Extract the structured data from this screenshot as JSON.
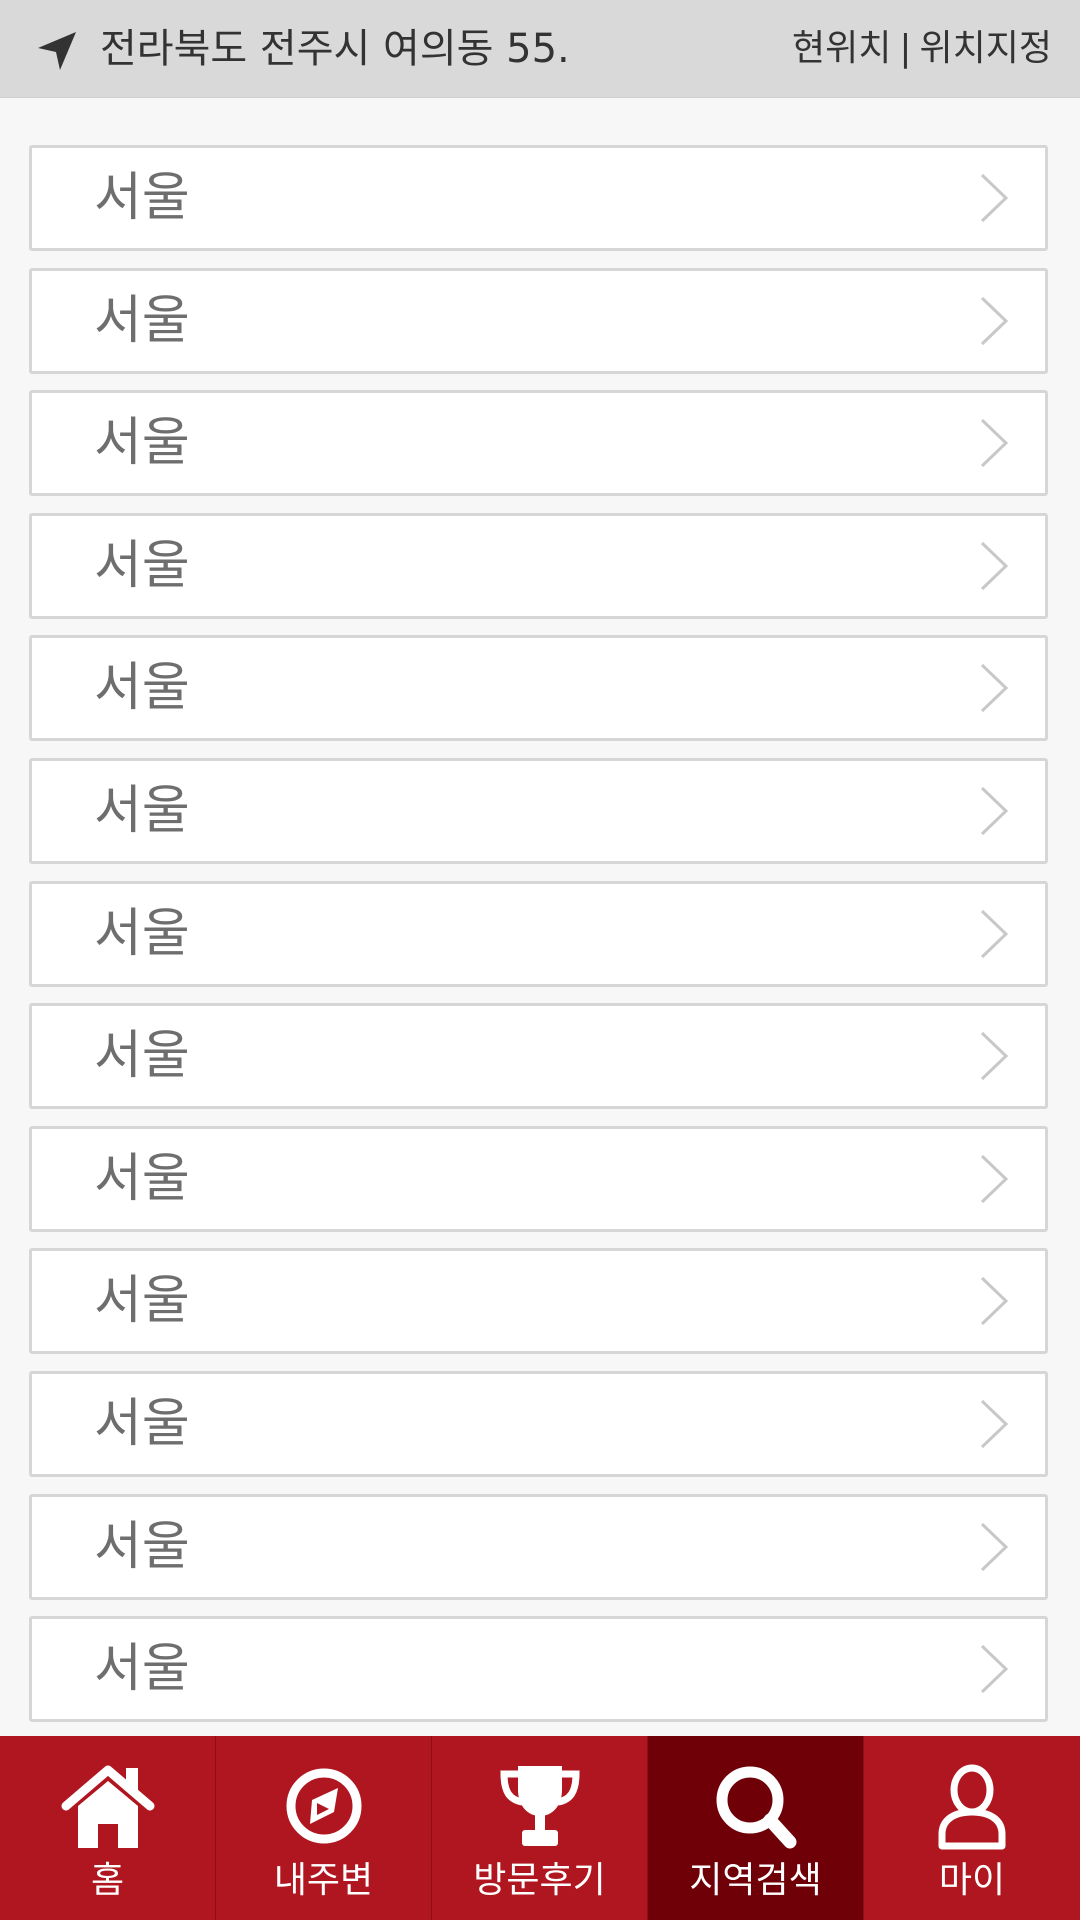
{
  "header": {
    "address": "전라북도 전주시 여의동 55...",
    "current_location_label": "현위치",
    "separator": "|",
    "set_location_label": "위치지정",
    "location_icon": "navigation-arrow-icon"
  },
  "regions": {
    "items": [
      {
        "label": "서울"
      },
      {
        "label": "서울"
      },
      {
        "label": "서울"
      },
      {
        "label": "서울"
      },
      {
        "label": "서울"
      },
      {
        "label": "서울"
      },
      {
        "label": "서울"
      },
      {
        "label": "서울"
      },
      {
        "label": "서울"
      },
      {
        "label": "서울"
      },
      {
        "label": "서울"
      },
      {
        "label": "서울"
      },
      {
        "label": "서울"
      }
    ],
    "row_icon": "chevron-right-icon"
  },
  "tabs": {
    "items": [
      {
        "label": "홈",
        "icon": "home-icon"
      },
      {
        "label": "내주변",
        "icon": "compass-icon"
      },
      {
        "label": "방문후기",
        "icon": "trophy-icon"
      },
      {
        "label": "지역검색",
        "icon": "search-icon",
        "active": true
      },
      {
        "label": "마이",
        "icon": "user-icon"
      }
    ]
  },
  "colors": {
    "tabbar": "#b0161f",
    "tab_active": "#6f0008",
    "header_bg": "#d9d9d9",
    "page_bg": "#f7f7f7"
  }
}
